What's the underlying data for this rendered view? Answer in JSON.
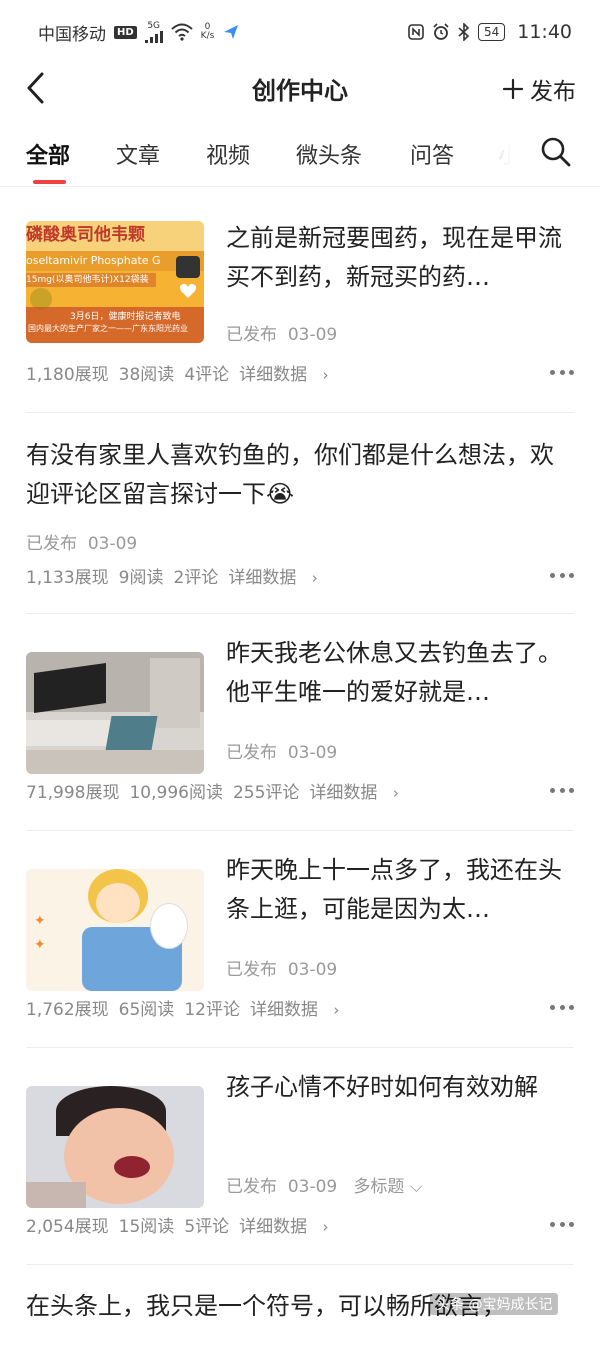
{
  "status": {
    "carrier": "中国移动",
    "hd": "HD",
    "net": "5G",
    "speed_value": "0",
    "speed_unit": "K/s",
    "battery": "54",
    "time": "11:40"
  },
  "nav": {
    "title": "创作中心",
    "publish_label": "发布"
  },
  "tabs": [
    "全部",
    "文章",
    "视频",
    "微头条",
    "问答",
    "小"
  ],
  "items": [
    {
      "title": "之前是新冠要囤药，现在是甲流买不到药，新冠买的药…",
      "status": "已发布",
      "date": "03-09",
      "views": "1,180展现",
      "reads": "38阅读",
      "comments": "4评论",
      "detail": "详细数据",
      "thumb_text_1": "磷酸奥司他韦颗",
      "thumb_text_2": "oseltamivir Phosphate G",
      "thumb_text_3": "15mg(以奥司他韦计)X12袋装",
      "thumb_text_4": "3月6日，健康时报记者致电",
      "thumb_text_5": "国内最大的生产厂家之一——广东东阳光药业"
    },
    {
      "title": "有没有家里人喜欢钓鱼的，你们都是什么想法，欢迎评论区留言探讨一下😭",
      "status": "已发布",
      "date": "03-09",
      "views": "1,133展现",
      "reads": "9阅读",
      "comments": "2评论",
      "detail": "详细数据"
    },
    {
      "title": "昨天我老公休息又去钓鱼去了。他平生唯一的爱好就是…",
      "status": "已发布",
      "date": "03-09",
      "views": "71,998展现",
      "reads": "10,996阅读",
      "comments": "255评论",
      "detail": "详细数据"
    },
    {
      "title": "昨天晚上十一点多了，我还在头条上逛，可能是因为太…",
      "status": "已发布",
      "date": "03-09",
      "views": "1,762展现",
      "reads": "65阅读",
      "comments": "12评论",
      "detail": "详细数据"
    },
    {
      "title": "孩子心情不好时如何有效劝解",
      "status": "已发布",
      "date": "03-09",
      "extra": "多标题",
      "views": "2,054展现",
      "reads": "15阅读",
      "comments": "5评论",
      "detail": "详细数据"
    },
    {
      "title": "在头条上，我只是一个符号，可以畅所欲言，"
    }
  ],
  "watermark": "头条 @宝妈成长记"
}
